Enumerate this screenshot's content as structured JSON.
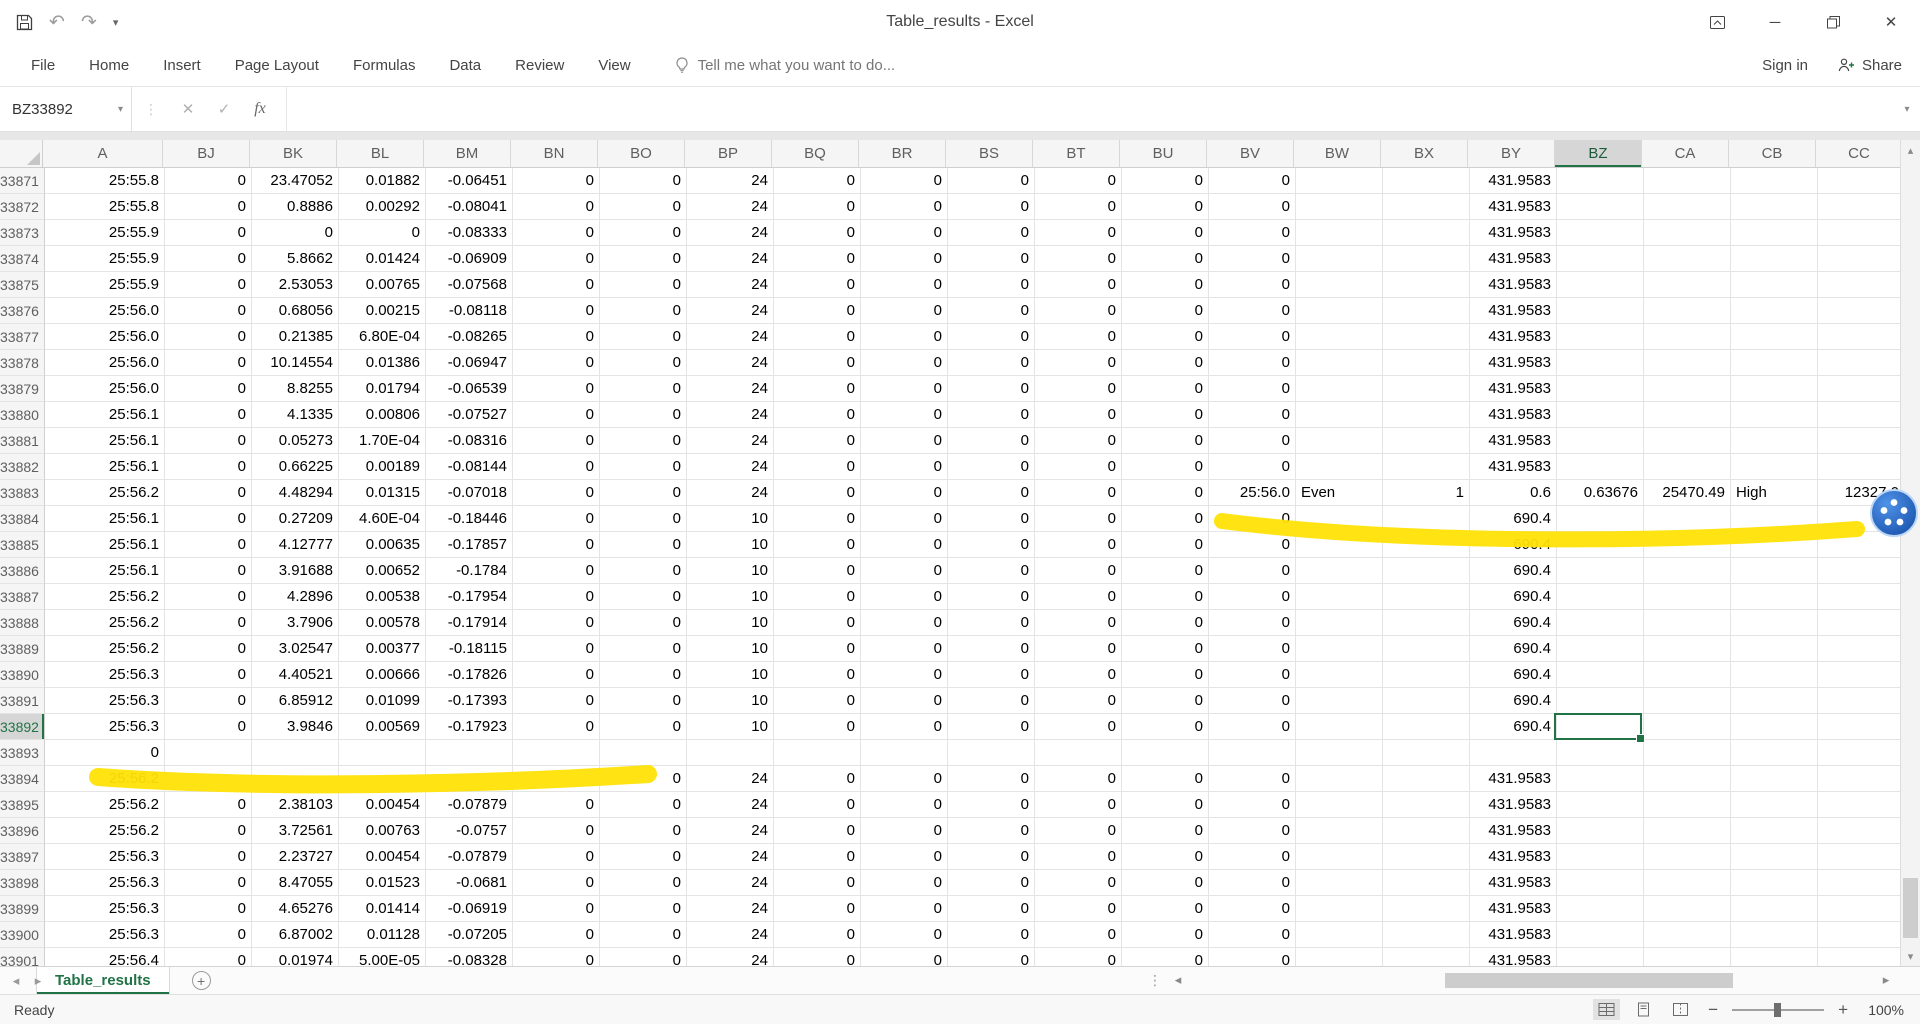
{
  "title_bar": {
    "title": "Table_results - Excel"
  },
  "quick_access": {
    "icons": [
      "save",
      "undo",
      "redo",
      "customize-quick-access"
    ]
  },
  "ribbon": {
    "tabs": [
      "File",
      "Home",
      "Insert",
      "Page Layout",
      "Formulas",
      "Data",
      "Review",
      "View"
    ],
    "tell_me": "Tell me what you want to do...",
    "sign_in": "Sign in",
    "share": "Share"
  },
  "formula_bar": {
    "name_box": "BZ33892",
    "formula": ""
  },
  "grid": {
    "columns": [
      "A",
      "BJ",
      "BK",
      "BL",
      "BM",
      "BN",
      "BO",
      "BP",
      "BQ",
      "BR",
      "BS",
      "BT",
      "BU",
      "BV",
      "BW",
      "BX",
      "BY",
      "BZ",
      "CA",
      "CB",
      "CC"
    ],
    "selection": {
      "cell": "BZ33892",
      "col": "BZ",
      "row": "33892"
    },
    "rows": [
      {
        "n": "33871",
        "c": [
          "25:55.8",
          "0",
          "23.47052",
          "0.01882",
          "-0.06451",
          "0",
          "0",
          "24",
          "0",
          "0",
          "0",
          "0",
          "0",
          "0",
          "",
          "",
          "431.9583",
          "",
          "",
          "",
          ""
        ]
      },
      {
        "n": "33872",
        "c": [
          "25:55.8",
          "0",
          "0.8886",
          "0.00292",
          "-0.08041",
          "0",
          "0",
          "24",
          "0",
          "0",
          "0",
          "0",
          "0",
          "0",
          "",
          "",
          "431.9583",
          "",
          "",
          "",
          ""
        ]
      },
      {
        "n": "33873",
        "c": [
          "25:55.9",
          "0",
          "0",
          "0",
          "-0.08333",
          "0",
          "0",
          "24",
          "0",
          "0",
          "0",
          "0",
          "0",
          "0",
          "",
          "",
          "431.9583",
          "",
          "",
          "",
          ""
        ]
      },
      {
        "n": "33874",
        "c": [
          "25:55.9",
          "0",
          "5.8662",
          "0.01424",
          "-0.06909",
          "0",
          "0",
          "24",
          "0",
          "0",
          "0",
          "0",
          "0",
          "0",
          "",
          "",
          "431.9583",
          "",
          "",
          "",
          ""
        ]
      },
      {
        "n": "33875",
        "c": [
          "25:55.9",
          "0",
          "2.53053",
          "0.00765",
          "-0.07568",
          "0",
          "0",
          "24",
          "0",
          "0",
          "0",
          "0",
          "0",
          "0",
          "",
          "",
          "431.9583",
          "",
          "",
          "",
          ""
        ]
      },
      {
        "n": "33876",
        "c": [
          "25:56.0",
          "0",
          "0.68056",
          "0.00215",
          "-0.08118",
          "0",
          "0",
          "24",
          "0",
          "0",
          "0",
          "0",
          "0",
          "0",
          "",
          "",
          "431.9583",
          "",
          "",
          "",
          ""
        ]
      },
      {
        "n": "33877",
        "c": [
          "25:56.0",
          "0",
          "0.21385",
          "6.80E-04",
          "-0.08265",
          "0",
          "0",
          "24",
          "0",
          "0",
          "0",
          "0",
          "0",
          "0",
          "",
          "",
          "431.9583",
          "",
          "",
          "",
          ""
        ]
      },
      {
        "n": "33878",
        "c": [
          "25:56.0",
          "0",
          "10.14554",
          "0.01386",
          "-0.06947",
          "0",
          "0",
          "24",
          "0",
          "0",
          "0",
          "0",
          "0",
          "0",
          "",
          "",
          "431.9583",
          "",
          "",
          "",
          ""
        ]
      },
      {
        "n": "33879",
        "c": [
          "25:56.0",
          "0",
          "8.8255",
          "0.01794",
          "-0.06539",
          "0",
          "0",
          "24",
          "0",
          "0",
          "0",
          "0",
          "0",
          "0",
          "",
          "",
          "431.9583",
          "",
          "",
          "",
          ""
        ]
      },
      {
        "n": "33880",
        "c": [
          "25:56.1",
          "0",
          "4.1335",
          "0.00806",
          "-0.07527",
          "0",
          "0",
          "24",
          "0",
          "0",
          "0",
          "0",
          "0",
          "0",
          "",
          "",
          "431.9583",
          "",
          "",
          "",
          ""
        ]
      },
      {
        "n": "33881",
        "c": [
          "25:56.1",
          "0",
          "0.05273",
          "1.70E-04",
          "-0.08316",
          "0",
          "0",
          "24",
          "0",
          "0",
          "0",
          "0",
          "0",
          "0",
          "",
          "",
          "431.9583",
          "",
          "",
          "",
          ""
        ]
      },
      {
        "n": "33882",
        "c": [
          "25:56.1",
          "0",
          "0.66225",
          "0.00189",
          "-0.08144",
          "0",
          "0",
          "24",
          "0",
          "0",
          "0",
          "0",
          "0",
          "0",
          "",
          "",
          "431.9583",
          "",
          "",
          "",
          ""
        ]
      },
      {
        "n": "33883",
        "c": [
          "25:56.2",
          "0",
          "4.48294",
          "0.01315",
          "-0.07018",
          "0",
          "0",
          "24",
          "0",
          "0",
          "0",
          "0",
          "0",
          "25:56.0",
          "Even",
          "1",
          "0.6",
          "0.63676",
          "25470.49",
          "High",
          "12327.0"
        ]
      },
      {
        "n": "33884",
        "c": [
          "25:56.1",
          "0",
          "0.27209",
          "4.60E-04",
          "-0.18446",
          "0",
          "0",
          "10",
          "0",
          "0",
          "0",
          "0",
          "0",
          "0",
          "",
          "",
          "690.4",
          "",
          "",
          "",
          ""
        ]
      },
      {
        "n": "33885",
        "c": [
          "25:56.1",
          "0",
          "4.12777",
          "0.00635",
          "-0.17857",
          "0",
          "0",
          "10",
          "0",
          "0",
          "0",
          "0",
          "0",
          "0",
          "",
          "",
          "690.4",
          "",
          "",
          "",
          ""
        ]
      },
      {
        "n": "33886",
        "c": [
          "25:56.1",
          "0",
          "3.91688",
          "0.00652",
          "-0.1784",
          "0",
          "0",
          "10",
          "0",
          "0",
          "0",
          "0",
          "0",
          "0",
          "",
          "",
          "690.4",
          "",
          "",
          "",
          ""
        ]
      },
      {
        "n": "33887",
        "c": [
          "25:56.2",
          "0",
          "4.2896",
          "0.00538",
          "-0.17954",
          "0",
          "0",
          "10",
          "0",
          "0",
          "0",
          "0",
          "0",
          "0",
          "",
          "",
          "690.4",
          "",
          "",
          "",
          ""
        ]
      },
      {
        "n": "33888",
        "c": [
          "25:56.2",
          "0",
          "3.7906",
          "0.00578",
          "-0.17914",
          "0",
          "0",
          "10",
          "0",
          "0",
          "0",
          "0",
          "0",
          "0",
          "",
          "",
          "690.4",
          "",
          "",
          "",
          ""
        ]
      },
      {
        "n": "33889",
        "c": [
          "25:56.2",
          "0",
          "3.02547",
          "0.00377",
          "-0.18115",
          "0",
          "0",
          "10",
          "0",
          "0",
          "0",
          "0",
          "0",
          "0",
          "",
          "",
          "690.4",
          "",
          "",
          "",
          ""
        ]
      },
      {
        "n": "33890",
        "c": [
          "25:56.3",
          "0",
          "4.40521",
          "0.00666",
          "-0.17826",
          "0",
          "0",
          "10",
          "0",
          "0",
          "0",
          "0",
          "0",
          "0",
          "",
          "",
          "690.4",
          "",
          "",
          "",
          ""
        ]
      },
      {
        "n": "33891",
        "c": [
          "25:56.3",
          "0",
          "6.85912",
          "0.01099",
          "-0.17393",
          "0",
          "0",
          "10",
          "0",
          "0",
          "0",
          "0",
          "0",
          "0",
          "",
          "",
          "690.4",
          "",
          "",
          "",
          ""
        ]
      },
      {
        "n": "33892",
        "c": [
          "25:56.3",
          "0",
          "3.9846",
          "0.00569",
          "-0.17923",
          "0",
          "0",
          "10",
          "0",
          "0",
          "0",
          "0",
          "0",
          "0",
          "",
          "",
          "690.4",
          "",
          "",
          "",
          ""
        ]
      },
      {
        "n": "33893",
        "c": [
          "0",
          "",
          "",
          "",
          "",
          "",
          "",
          "",
          "",
          "",
          "",
          "",
          "",
          "",
          "",
          "",
          "",
          "",
          "",
          "",
          ""
        ]
      },
      {
        "n": "33894",
        "c": [
          "25:56.2",
          "",
          "",
          "",
          "",
          "",
          "0",
          "24",
          "0",
          "0",
          "0",
          "0",
          "0",
          "0",
          "",
          "",
          "431.9583",
          "",
          "",
          "",
          ""
        ]
      },
      {
        "n": "33895",
        "c": [
          "25:56.2",
          "0",
          "2.38103",
          "0.00454",
          "-0.07879",
          "0",
          "0",
          "24",
          "0",
          "0",
          "0",
          "0",
          "0",
          "0",
          "",
          "",
          "431.9583",
          "",
          "",
          "",
          ""
        ]
      },
      {
        "n": "33896",
        "c": [
          "25:56.2",
          "0",
          "3.72561",
          "0.00763",
          "-0.0757",
          "0",
          "0",
          "24",
          "0",
          "0",
          "0",
          "0",
          "0",
          "0",
          "",
          "",
          "431.9583",
          "",
          "",
          "",
          ""
        ]
      },
      {
        "n": "33897",
        "c": [
          "25:56.3",
          "0",
          "2.23727",
          "0.00454",
          "-0.07879",
          "0",
          "0",
          "24",
          "0",
          "0",
          "0",
          "0",
          "0",
          "0",
          "",
          "",
          "431.9583",
          "",
          "",
          "",
          ""
        ]
      },
      {
        "n": "33898",
        "c": [
          "25:56.3",
          "0",
          "8.47055",
          "0.01523",
          "-0.0681",
          "0",
          "0",
          "24",
          "0",
          "0",
          "0",
          "0",
          "0",
          "0",
          "",
          "",
          "431.9583",
          "",
          "",
          "",
          ""
        ]
      },
      {
        "n": "33899",
        "c": [
          "25:56.3",
          "0",
          "4.65276",
          "0.01414",
          "-0.06919",
          "0",
          "0",
          "24",
          "0",
          "0",
          "0",
          "0",
          "0",
          "0",
          "",
          "",
          "431.9583",
          "",
          "",
          "",
          ""
        ]
      },
      {
        "n": "33900",
        "c": [
          "25:56.3",
          "0",
          "6.87002",
          "0.01128",
          "-0.07205",
          "0",
          "0",
          "24",
          "0",
          "0",
          "0",
          "0",
          "0",
          "0",
          "",
          "",
          "431.9583",
          "",
          "",
          "",
          ""
        ]
      },
      {
        "n": "33901",
        "c": [
          "25:56.4",
          "0",
          "0.01974",
          "5.00E-05",
          "-0.08328",
          "0",
          "0",
          "24",
          "0",
          "0",
          "0",
          "0",
          "0",
          "0",
          "",
          "",
          "431.9583",
          "",
          "",
          "",
          ""
        ]
      }
    ]
  },
  "annotations": {
    "highlighter_color": "#ffe205",
    "highlighted_rows": [
      "33884",
      "33894"
    ],
    "badge": "app-badge"
  },
  "sheet_tabs": {
    "tabs": [
      {
        "label": "Table_results",
        "active": true
      }
    ]
  },
  "status_bar": {
    "status": "Ready",
    "zoom": "100%",
    "views": [
      "normal",
      "page-layout",
      "page-break-preview"
    ],
    "accent_color": "#217346"
  }
}
